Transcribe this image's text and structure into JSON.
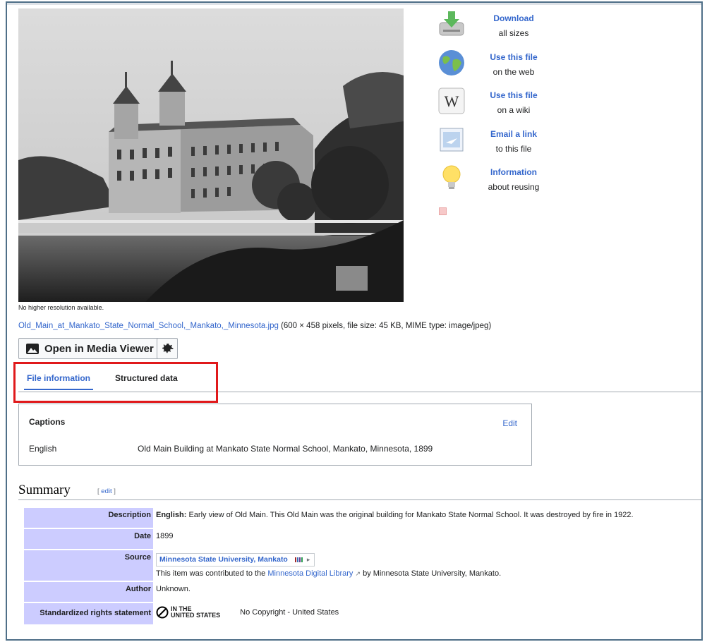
{
  "image": {
    "no_higher_res": "No higher resolution available.",
    "filename": "Old_Main_at_Mankato_State_Normal_School,_Mankato,_Minnesota.jpg",
    "file_meta": "(600 × 458 pixels, file size: 45 KB, MIME type: image/jpeg)"
  },
  "viewer": {
    "open_label": "Open in Media Viewer",
    "settings_icon": "gear-icon"
  },
  "actions": [
    {
      "title": "Download",
      "sub": "all sizes",
      "icon": "download-icon"
    },
    {
      "title": "Use this file",
      "sub": "on the web",
      "icon": "globe-icon"
    },
    {
      "title": "Use this file",
      "sub": "on a wiki",
      "icon": "wikipedia-icon"
    },
    {
      "title": "Email a link",
      "sub": "to this file",
      "icon": "email-icon"
    },
    {
      "title": "Information",
      "sub": "about reusing",
      "icon": "lightbulb-icon"
    }
  ],
  "tabs": [
    {
      "label": "File information",
      "active": true
    },
    {
      "label": "Structured data",
      "active": false
    }
  ],
  "captions": {
    "title": "Captions",
    "edit": "Edit",
    "language": "English",
    "text": "Old Main Building at Mankato State Normal School, Mankato, Minnesota, 1899"
  },
  "summary": {
    "heading": "Summary",
    "edit_open": "[ ",
    "edit_label": "edit",
    "edit_close": " ]",
    "rows": {
      "description_key": "Description",
      "description_lang": "English:",
      "description_text": " Early view of Old Main. This Old Main was the original building for Mankato State Normal School. It was destroyed by fire in 1922.",
      "date_key": "Date",
      "date_value": "1899",
      "source_key": "Source",
      "source_name": "Minnesota State University, Mankato",
      "source_note_pre": "This item was contributed to the ",
      "source_note_link": "Minnesota Digital Library",
      "source_note_post": " by Minnesota State University, Mankato.",
      "author_key": "Author",
      "author_value": "Unknown.",
      "rights_key": "Standardized rights statement",
      "rights_logo_line1": "IN THE",
      "rights_logo_line2": "UNITED STATES",
      "rights_value": "No Copyright - United States"
    }
  },
  "colors": {
    "link": "#3366cc",
    "key_bg": "#ccccff",
    "highlight": "#e0191b"
  }
}
